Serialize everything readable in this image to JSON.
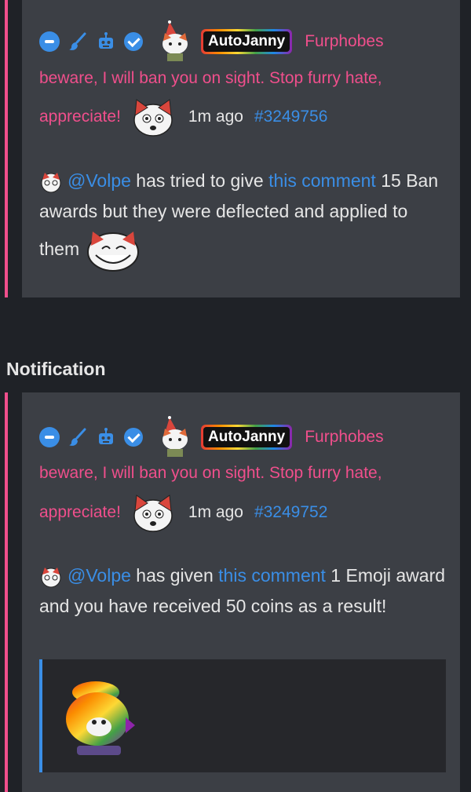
{
  "notifications": [
    {
      "username": "AutoJanny",
      "flair_line1": "Furphobes",
      "flair_line2": "beware, I will ban you on sight. Stop furry hate,",
      "flair_line3": "appreciate!",
      "time": "1m ago",
      "comment_id": "#3249756",
      "mention": "@Volpe",
      "text_a": " has tried to give ",
      "link_text": "this comment",
      "text_b": " 15 Ban awards but they were deflected and applied to them"
    },
    {
      "heading": "Notification",
      "username": "AutoJanny",
      "flair_line1": "Furphobes",
      "flair_line2": "beware, I will ban you on sight. Stop furry hate,",
      "flair_line3": "appreciate!",
      "time": "1m ago",
      "comment_id": "#3249752",
      "mention": "@Volpe",
      "text_a": " has given ",
      "link_text": "this comment",
      "text_b": " 1 Emoji award and you have received 50 coins as a result!"
    }
  ],
  "icons": [
    "minus-circle-icon",
    "brush-icon",
    "robot-icon",
    "verified-check-icon"
  ],
  "colors": {
    "background": "#1f2227",
    "card": "#3c3f45",
    "accent_pink": "#f04f8c",
    "link_blue": "#3a8ee6"
  }
}
